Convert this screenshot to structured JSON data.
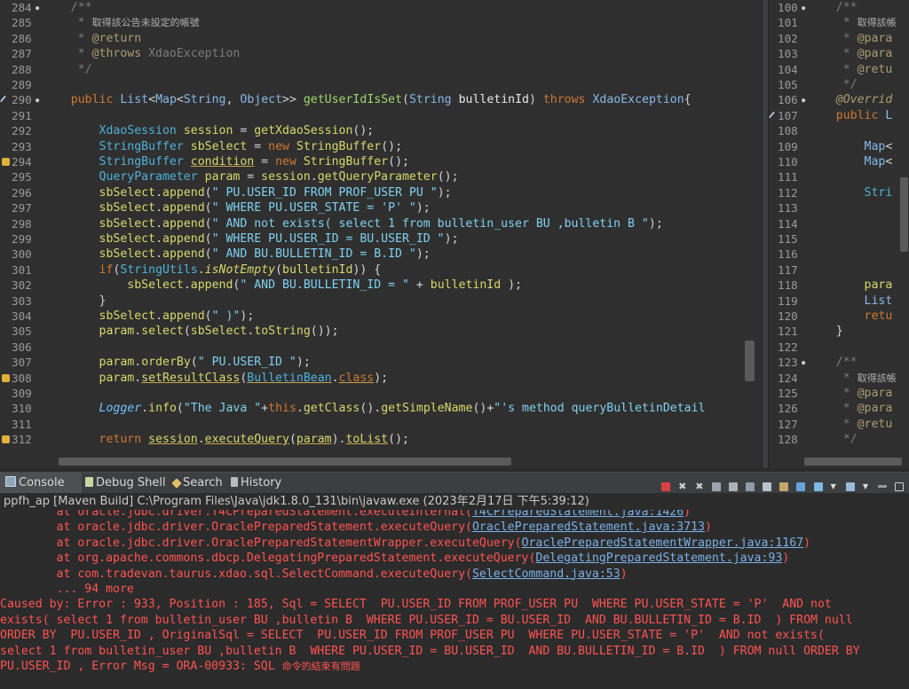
{
  "editor_left": {
    "lines": [
      {
        "n": "284",
        "fold": "minus",
        "html": "    <span class='cm'>/**</span>"
      },
      {
        "n": "285",
        "html": "     <span class='cm'>* </span><span class='cmk'>取得該公告未設定的帳號</span>"
      },
      {
        "n": "286",
        "html": "     <span class='cm'>* </span><span class='an'>@return</span>"
      },
      {
        "n": "287",
        "html": "     <span class='cm'>* </span><span class='an'>@throws</span><span class='cm'> XdaoException</span>"
      },
      {
        "n": "288",
        "html": "     <span class='cm'>*/</span>"
      },
      {
        "n": "289",
        "html": ""
      },
      {
        "n": "290",
        "fold": "minus",
        "marker": "override",
        "html": "    <span class='kw'>public</span> <span class='tyl'>List</span>&lt;<span class='tyl'>Map</span>&lt;<span class='tyl'>String</span>, <span class='tyl'>Object</span>&gt;&gt; <span class='fn'>getUserIdIsSet</span>(<span class='tyl'>String</span> <span class='var'>bulletinId</span>) <span class='kw'>throws</span> <span class='tyl'>XdaoException</span>{"
      },
      {
        "n": "291",
        "html": ""
      },
      {
        "n": "292",
        "html": "        <span class='ty'>XdaoSession</span> <span class='fnY'>session</span> = <span class='fnY'>getXdaoSession</span>();"
      },
      {
        "n": "293",
        "html": "        <span class='ty'>StringBuffer</span> <span class='fnY'>sbSelect</span> = <span class='kw'>new</span> <span class='fnY'>StringBuffer</span>();"
      },
      {
        "n": "294",
        "marker": "warning",
        "html": "        <span class='ty'>StringBuffer</span> <span class='fnY ul'>condition</span> = <span class='kw'>new</span> <span class='fnY'>StringBuffer</span>();"
      },
      {
        "n": "295",
        "html": "        <span class='ty'>QueryParameter</span> <span class='fnY'>param</span> = <span class='fnY'>session</span>.<span class='fnY'>getQueryParameter</span>();"
      },
      {
        "n": "296",
        "html": "        <span class='fnY'>sbSelect</span>.<span class='fnY'>append</span>(<span class='st'>\" PU.USER_ID FROM PROF_USER PU \"</span>);"
      },
      {
        "n": "297",
        "html": "        <span class='fnY'>sbSelect</span>.<span class='fnY'>append</span>(<span class='st'>\" WHERE PU.USER_STATE = 'P' \"</span>);"
      },
      {
        "n": "298",
        "html": "        <span class='fnY'>sbSelect</span>.<span class='fnY'>append</span>(<span class='st'>\" AND not exists( select 1 from bulletin_user BU ,bulletin B \"</span>);"
      },
      {
        "n": "299",
        "html": "        <span class='fnY'>sbSelect</span>.<span class='fnY'>append</span>(<span class='st'>\" WHERE PU.USER_ID = BU.USER_ID \"</span>);"
      },
      {
        "n": "300",
        "html": "        <span class='fnY'>sbSelect</span>.<span class='fnY'>append</span>(<span class='st'>\" AND BU.BULLETIN_ID = B.ID \"</span>);"
      },
      {
        "n": "301",
        "html": "        <span class='kw'>if</span>(<span class='ty'>StringUtils</span>.<span class='fnY it'>isNotEmpty</span>(<span class='fnY'>bulletinId</span>)) {"
      },
      {
        "n": "302",
        "html": "            <span class='fnY'>sbSelect</span>.<span class='fnY'>append</span>(<span class='st'>\" AND BU.BULLETIN_ID = \"</span> + <span class='fnY'>bulletinId</span> );"
      },
      {
        "n": "303",
        "html": "        }"
      },
      {
        "n": "304",
        "html": "        <span class='fnY'>sbSelect</span>.<span class='fnY'>append</span>(<span class='st'>\" )\"</span>);"
      },
      {
        "n": "305",
        "html": "        <span class='fnY'>param</span>.<span class='fnY'>select</span>(<span class='fnY'>sbSelect</span>.<span class='fnY'>toString</span>());"
      },
      {
        "n": "306",
        "html": ""
      },
      {
        "n": "307",
        "html": "        <span class='fnY'>param</span>.<span class='fnY'>orderBy</span>(<span class='st'>\" PU.USER_ID \"</span>);"
      },
      {
        "n": "308",
        "marker": "warning",
        "html": "        <span class='fnY'>param</span>.<span class='fnY ul'>setResultClass</span>(<span class='ty ul'>BulletinBean</span>.<span class='kw ul'>class</span>);"
      },
      {
        "n": "309",
        "html": ""
      },
      {
        "n": "310",
        "html": "        <span class='fld it'>Logger</span>.<span class='fnY'>info</span>(<span class='st'>\"The Java \"</span>+<span class='kw'>this</span>.<span class='fnY'>getClass</span>().<span class='fnY'>getSimpleName</span>()+<span class='st'>\"'s method queryBulletinDetail</span>"
      },
      {
        "n": "311",
        "html": ""
      },
      {
        "n": "312",
        "marker": "warning",
        "html": "        <span class='kw'>return</span> <span class='fnY ul'>session</span>.<span class='fnY ul'>executeQuery</span>(<span class='fnY ul'>param</span>).<span class='fnY ul'>toList</span>();"
      }
    ]
  },
  "editor_right": {
    "lines": [
      {
        "n": "100",
        "fold": "minus",
        "html": "    <span class='cm'>/**</span>"
      },
      {
        "n": "101",
        "html": "     <span class='cm'>* </span><span class='cmk'>取得該帳</span>"
      },
      {
        "n": "102",
        "html": "     <span class='cm'>* </span><span class='an'>@para</span>"
      },
      {
        "n": "103",
        "html": "     <span class='cm'>* </span><span class='an'>@para</span>"
      },
      {
        "n": "104",
        "html": "     <span class='cm'>* </span><span class='an'>@retu</span>"
      },
      {
        "n": "105",
        "html": "     <span class='cm'>*/</span>"
      },
      {
        "n": "106",
        "fold": "minus",
        "html": "    <span class='an it'>@Overrid</span>"
      },
      {
        "n": "107",
        "marker": "override",
        "html": "    <span class='kw'>public</span> <span class='tyl'>L</span>"
      },
      {
        "n": "108",
        "html": ""
      },
      {
        "n": "109",
        "html": "        <span class='tyl'>Map</span>&lt;"
      },
      {
        "n": "110",
        "html": "        <span class='tyl'>Map</span>&lt;"
      },
      {
        "n": "111",
        "html": ""
      },
      {
        "n": "112",
        "html": "        <span class='ty'>Stri</span>"
      },
      {
        "n": "113",
        "html": ""
      },
      {
        "n": "114",
        "html": ""
      },
      {
        "n": "115",
        "html": ""
      },
      {
        "n": "116",
        "html": ""
      },
      {
        "n": "117",
        "html": ""
      },
      {
        "n": "118",
        "html": "        <span class='fnY'>para</span>"
      },
      {
        "n": "119",
        "html": "        <span class='tyl'>List</span>"
      },
      {
        "n": "120",
        "html": "        <span class='kw'>retu</span>"
      },
      {
        "n": "121",
        "html": "    }"
      },
      {
        "n": "122",
        "html": ""
      },
      {
        "n": "123",
        "fold": "minus",
        "html": "    <span class='cm'>/**</span>"
      },
      {
        "n": "124",
        "html": "     <span class='cm'>* </span><span class='cmk'>取得該帳</span>"
      },
      {
        "n": "125",
        "html": "     <span class='cm'>* </span><span class='an'>@para</span>"
      },
      {
        "n": "126",
        "html": "     <span class='cm'>* </span><span class='an'>@para</span>"
      },
      {
        "n": "127",
        "html": "     <span class='cm'>* </span><span class='an'>@retu</span>"
      },
      {
        "n": "128",
        "html": "     <span class='cm'>*/</span>"
      }
    ]
  },
  "console": {
    "tabs": [
      {
        "label": "Console",
        "icon": "console-icon",
        "color": "#9ab"
      },
      {
        "label": "Debug Shell",
        "icon": "debug-shell-icon",
        "color": "#cda"
      },
      {
        "label": "Search",
        "icon": "search-icon",
        "color": "#dc8"
      },
      {
        "label": "History",
        "icon": "history-icon",
        "color": "#bbb"
      }
    ],
    "info": "ppfh_ap [Maven Build] C:\\Program Files\\Java\\jdk1.8.0_131\\bin\\javaw.exe  (2023年2月17日 下午5:39:12)",
    "lines": [
      {
        "html": "        at oracle.jdbc.driver.T4CPreparedStatement.executeInternal(<a>T4CPreparedStatement.java:1426</a>)"
      },
      {
        "html": "        at oracle.jdbc.driver.OraclePreparedStatement.executeQuery(<a>OraclePreparedStatement.java:3713</a>)"
      },
      {
        "html": "        at oracle.jdbc.driver.OraclePreparedStatementWrapper.executeQuery(<a>OraclePreparedStatementWrapper.java:1167</a>)"
      },
      {
        "html": "        at org.apache.commons.dbcp.DelegatingPreparedStatement.executeQuery(<a>DelegatingPreparedStatement.java:93</a>)"
      },
      {
        "html": "        at com.tradevan.taurus.xdao.sql.SelectCommand.executeQuery(<a>SelectCommand.java:53</a>)"
      },
      {
        "html": "        ... 94 more"
      },
      {
        "html": "Caused by: Error : 933, Position : 185, Sql = SELECT  PU.USER_ID FROM PROF_USER PU  WHERE PU.USER_STATE = 'P'  AND not"
      },
      {
        "html": "exists( select 1 from bulletin_user BU ,bulletin B  WHERE PU.USER_ID = BU.USER_ID  AND BU.BULLETIN_ID = B.ID  ) FROM null"
      },
      {
        "html": "ORDER BY  PU.USER_ID , OriginalSql = SELECT  PU.USER_ID FROM PROF_USER PU  WHERE PU.USER_STATE = 'P'  AND not exists("
      },
      {
        "html": "select 1 from bulletin_user BU ,bulletin B  WHERE PU.USER_ID = BU.USER_ID  AND BU.BULLETIN_ID = B.ID  ) FROM null ORDER BY"
      },
      {
        "html": "PU.USER_ID , Error Msg = ORA-00933: SQL <span style='font-size:11px'>命令的結束有問題</span>"
      }
    ]
  }
}
